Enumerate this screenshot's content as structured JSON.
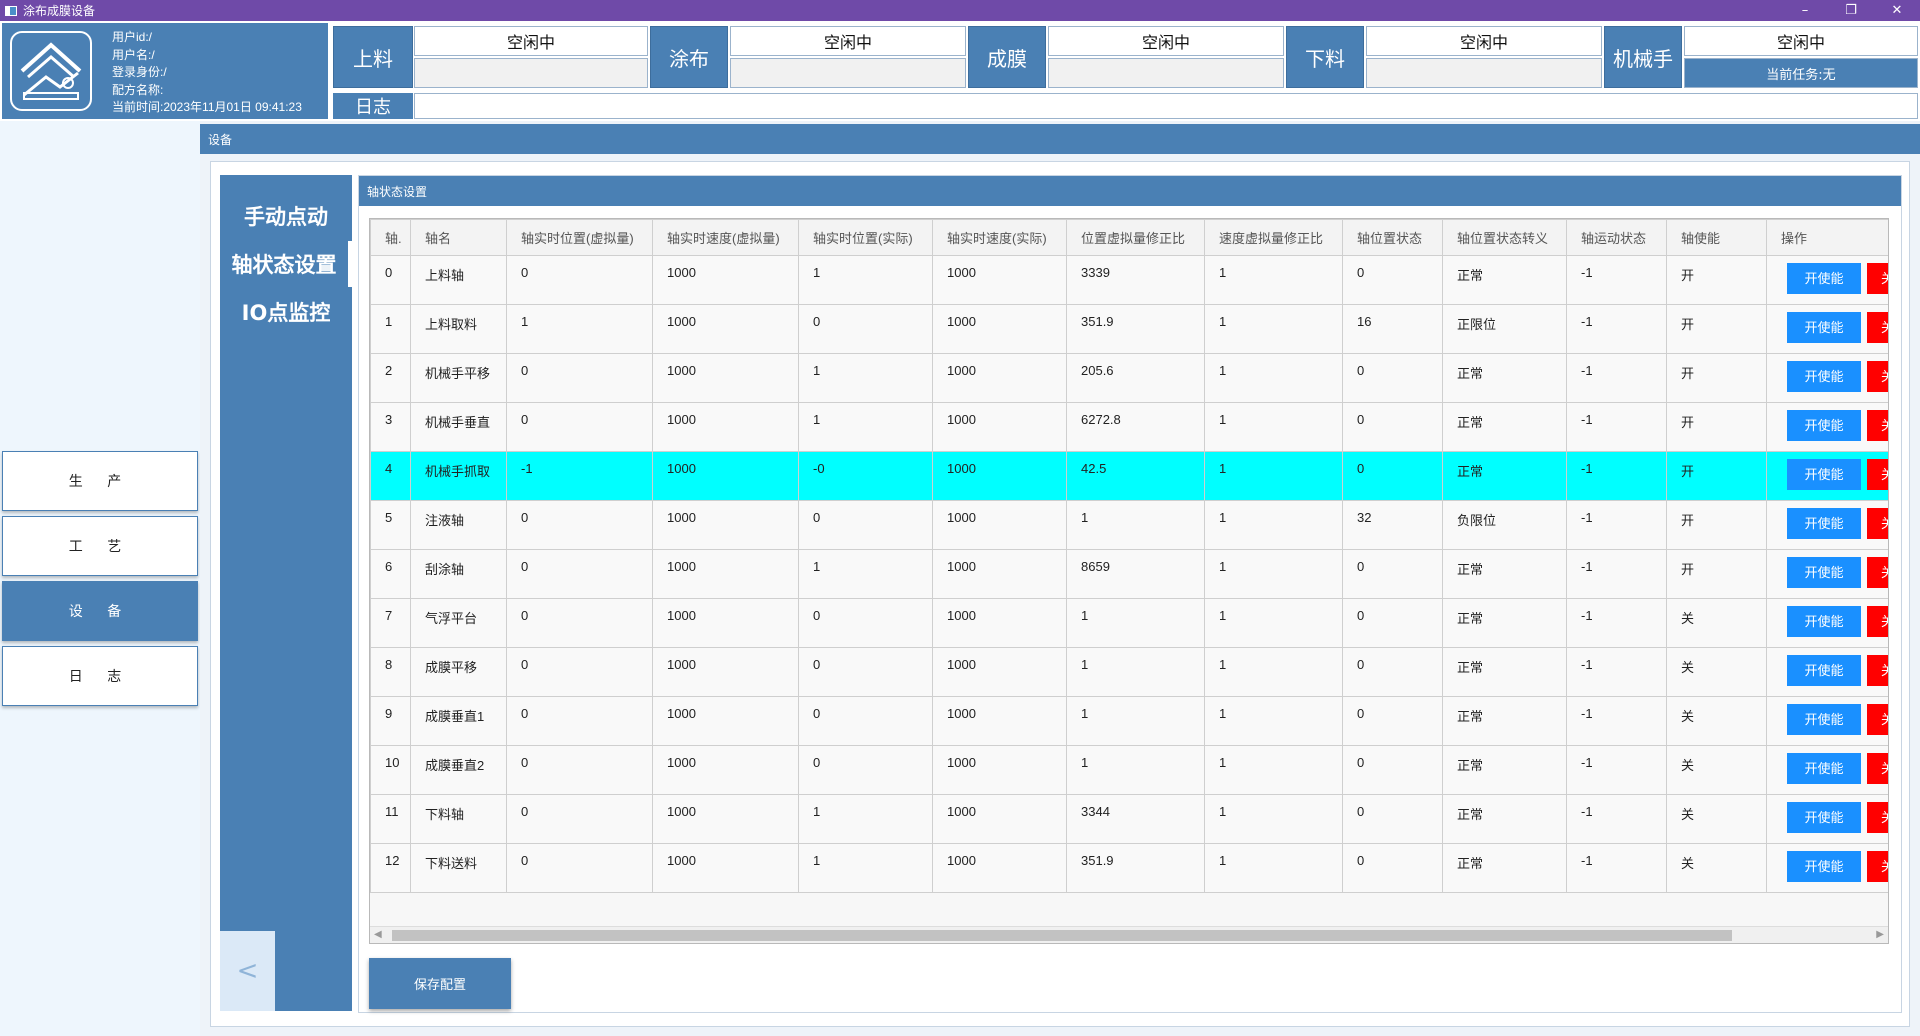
{
  "window": {
    "title": "涂布成膜设备",
    "minimize": "–",
    "restore": "❐",
    "close": "✕"
  },
  "user": {
    "id": "用户id:/",
    "name": "用户名:/",
    "role": "登录身份:/",
    "recipe": "配方名称:",
    "time": "当前时间:2023年11月01日 09:41:23"
  },
  "stations": [
    {
      "label": "上料",
      "status": "空闲中",
      "sub": ""
    },
    {
      "label": "涂布",
      "status": "空闲中",
      "sub": ""
    },
    {
      "label": "成膜",
      "status": "空闲中",
      "sub": ""
    },
    {
      "label": "下料",
      "status": "空闲中",
      "sub": ""
    },
    {
      "label": "机械手",
      "status": "空闲中",
      "sub": "当前任务:无"
    }
  ],
  "log": {
    "label": "日志",
    "value": ""
  },
  "nav": [
    "生 产",
    "工 艺",
    "设 备",
    "日 志"
  ],
  "nav_active": 2,
  "main_tab": "设备",
  "subnav": [
    "手动点动",
    "轴状态设置",
    "IO点监控"
  ],
  "subnav_active": 1,
  "back_arrow": "<",
  "panel_title": "轴状态设置",
  "table": {
    "headers": [
      "轴.",
      "轴名",
      "轴实时位置(虚拟量)",
      "轴实时速度(虚拟量)",
      "轴实时位置(实际)",
      "轴实时速度(实际)",
      "位置虚拟量修正比",
      "速度虚拟量修正比",
      "轴位置状态",
      "轴位置状态转义",
      "轴运动状态",
      "轴使能",
      "操作"
    ],
    "enable_label": "开使能",
    "disable_label": "关",
    "selected_row": 4,
    "rows": [
      [
        "0",
        "上料轴",
        "0",
        "1000",
        "1",
        "1000",
        "3339",
        "1",
        "0",
        "正常",
        "-1",
        "开"
      ],
      [
        "1",
        "上料取料",
        "1",
        "1000",
        "0",
        "1000",
        "351.9",
        "1",
        "16",
        "正限位",
        "-1",
        "开"
      ],
      [
        "2",
        "机械手平移",
        "0",
        "1000",
        "1",
        "1000",
        "205.6",
        "1",
        "0",
        "正常",
        "-1",
        "开"
      ],
      [
        "3",
        "机械手垂直",
        "0",
        "1000",
        "1",
        "1000",
        "6272.8",
        "1",
        "0",
        "正常",
        "-1",
        "开"
      ],
      [
        "4",
        "机械手抓取",
        "-1",
        "1000",
        "-0",
        "1000",
        "42.5",
        "1",
        "0",
        "正常",
        "-1",
        "开"
      ],
      [
        "5",
        "注液轴",
        "0",
        "1000",
        "0",
        "1000",
        "1",
        "1",
        "32",
        "负限位",
        "-1",
        "开"
      ],
      [
        "6",
        "刮涂轴",
        "0",
        "1000",
        "1",
        "1000",
        "8659",
        "1",
        "0",
        "正常",
        "-1",
        "开"
      ],
      [
        "7",
        "气浮平台",
        "0",
        "1000",
        "0",
        "1000",
        "1",
        "1",
        "0",
        "正常",
        "-1",
        "关"
      ],
      [
        "8",
        "成膜平移",
        "0",
        "1000",
        "0",
        "1000",
        "1",
        "1",
        "0",
        "正常",
        "-1",
        "关"
      ],
      [
        "9",
        "成膜垂直1",
        "0",
        "1000",
        "0",
        "1000",
        "1",
        "1",
        "0",
        "正常",
        "-1",
        "关"
      ],
      [
        "10",
        "成膜垂直2",
        "0",
        "1000",
        "0",
        "1000",
        "1",
        "1",
        "0",
        "正常",
        "-1",
        "关"
      ],
      [
        "11",
        "下料轴",
        "0",
        "1000",
        "1",
        "1000",
        "3344",
        "1",
        "0",
        "正常",
        "-1",
        "关"
      ],
      [
        "12",
        "下料送料",
        "0",
        "1000",
        "1",
        "1000",
        "351.9",
        "1",
        "0",
        "正常",
        "-1",
        "关"
      ]
    ]
  },
  "save_label": "保存配置",
  "colors": {
    "primary": "#4a80b4",
    "titlebar": "#6f4aa8",
    "selected_row": "#00ffff",
    "enable": "#1a90ff",
    "disable": "#ff0000"
  }
}
